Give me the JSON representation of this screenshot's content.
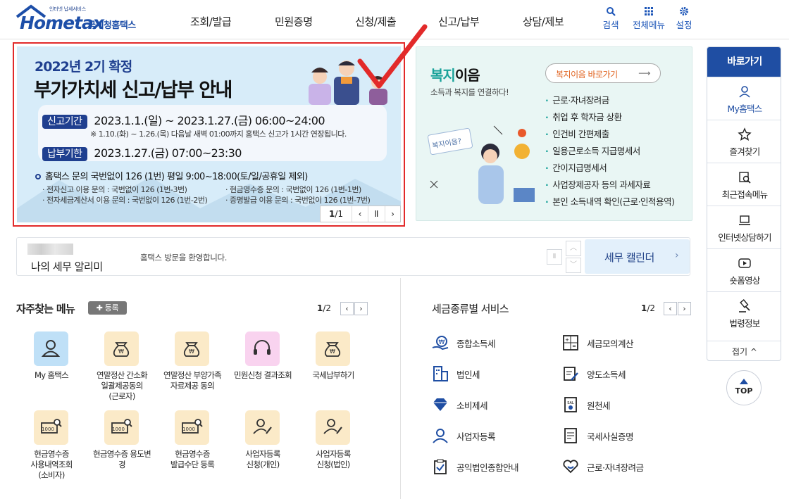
{
  "header": {
    "logo_sub": "인터넷 납세서비스",
    "logo_main": "Hometax",
    "logo_ko": "국세청홈택스",
    "nav": [
      "조회/발급",
      "민원증명",
      "신청/제출",
      "신고/납부",
      "상담/제보"
    ],
    "utils": [
      {
        "label": "검색",
        "icon": "search-icon"
      },
      {
        "label": "전체메뉴",
        "icon": "grid-menu-icon"
      },
      {
        "label": "설정",
        "icon": "gear-icon"
      }
    ]
  },
  "banner": {
    "year_line": "2022년 2기 확정",
    "title": "부가가치세 신고/납부 안내",
    "report_label": "신고기간",
    "report_date": "2023.1.1.(일) ~ 2023.1.27.(금) 06:00~24:00",
    "report_note": "※ 1.10.(화) ~ 1.26.(목) 다음날 새벽 01:00까지 홈택스 신고가 1시간 연장됩니다.",
    "pay_label": "납부기한",
    "pay_date": "2023.1.27.(금) 07:00~23:30",
    "inquiry": "홈택스 문의 국번없이 126 (1번)  평일 9:00~18:00(토/일/공휴일 제외)",
    "inquiry_rows": [
      "· 전자신고 이용 문의 : 국번없이 126 (1번-3번)",
      "· 현금영수증 문의 : 국번없이 126 (1번-1번)",
      "· 전자세금계산서 이용 문의 : 국번없이 126 (1번-2번)",
      "· 증명발급 이용 문의 : 국번없이 126 (1번-7번)"
    ],
    "pager_current": "1",
    "pager_total": "/1"
  },
  "welfare": {
    "title_a": "복지",
    "title_b": "이음",
    "subtitle": "소득과 복지를 연결하다!",
    "button_label": "복지이음 바로가기",
    "bubble": "복지이음?",
    "items": [
      "근로·자녀장려금",
      "취업 후 학자금 상환",
      "인건비 간편제출",
      "일용근로소득 지급명세서",
      "간이지급명세서",
      "사업장제공자 등의 과세자료",
      "본인 소득내역 확인(근로·인적용역)"
    ]
  },
  "quick": {
    "title": "바로가기",
    "items": [
      {
        "label": "My홈택스",
        "icon": "person-icon"
      },
      {
        "label": "즐겨찾기",
        "icon": "star-icon"
      },
      {
        "label": "최근접속메뉴",
        "icon": "recent-search-icon"
      },
      {
        "label": "인터넷상담하기",
        "icon": "laptop-icon"
      },
      {
        "label": "숏폼영상",
        "icon": "play-icon"
      },
      {
        "label": "법령정보",
        "icon": "gavel-icon"
      }
    ],
    "fold": "접기",
    "top": "TOP"
  },
  "alarm": {
    "label": "나의 세무 알리미",
    "message": "홈택스 방문을 환영합니다.",
    "calendar": "세무 캘린더"
  },
  "favorites": {
    "title": "자주찾는 메뉴",
    "register": "등록",
    "page_current": "1",
    "page_total": "/2",
    "items": [
      {
        "label": "My 홈택스",
        "icon": "person-icon",
        "color": "#bfe0f7"
      },
      {
        "label": "연말정산 간소화\n일괄제공동의\n(근로자)",
        "icon": "money-bag-icon",
        "color": "#fbeac8"
      },
      {
        "label": "연말정산 부양가족\n자료제공 동의",
        "icon": "money-bag-icon",
        "color": "#fbeac8"
      },
      {
        "label": "민원신청 결과조회",
        "icon": "headset-icon",
        "color": "#f9d3ef"
      },
      {
        "label": "국세납부하기",
        "icon": "money-bag-icon",
        "color": "#fbeac8"
      },
      {
        "label": "현금영수증\n사용내역조회\n(소비자)",
        "icon": "receipt-search-icon",
        "color": "#fbeac8"
      },
      {
        "label": "현금영수증 용도변\n경",
        "icon": "receipt-search-icon",
        "color": "#fbeac8"
      },
      {
        "label": "현금영수증\n발급수단 등록",
        "icon": "receipt-search-icon",
        "color": "#fbeac8"
      },
      {
        "label": "사업자등록\n신청(개인)",
        "icon": "person-edit-icon",
        "color": "#fbeac8"
      },
      {
        "label": "사업자등록\n신청(법인)",
        "icon": "person-edit-icon",
        "color": "#fbeac8"
      }
    ]
  },
  "tax_services": {
    "title": "세금종류별 서비스",
    "page_current": "1",
    "page_total": "/2",
    "items": [
      {
        "label": "종합소득세",
        "icon": "coin-hand-icon"
      },
      {
        "label": "세금모의계산",
        "icon": "calculator-icon"
      },
      {
        "label": "법인세",
        "icon": "building-icon"
      },
      {
        "label": "양도소득세",
        "icon": "document-edit-icon"
      },
      {
        "label": "소비제세",
        "icon": "diamond-icon"
      },
      {
        "label": "원천세",
        "icon": "salary-icon"
      },
      {
        "label": "사업자등록",
        "icon": "person-icon"
      },
      {
        "label": "국세사실증명",
        "icon": "certificate-icon"
      },
      {
        "label": "공익법인종합안내",
        "icon": "clipboard-check-icon"
      },
      {
        "label": "근로·자녀장려금",
        "icon": "heart-hand-icon"
      }
    ]
  },
  "colors": {
    "brand": "#1f4ea3",
    "accent_red": "#e22a2a",
    "teal": "#1aa39a"
  }
}
